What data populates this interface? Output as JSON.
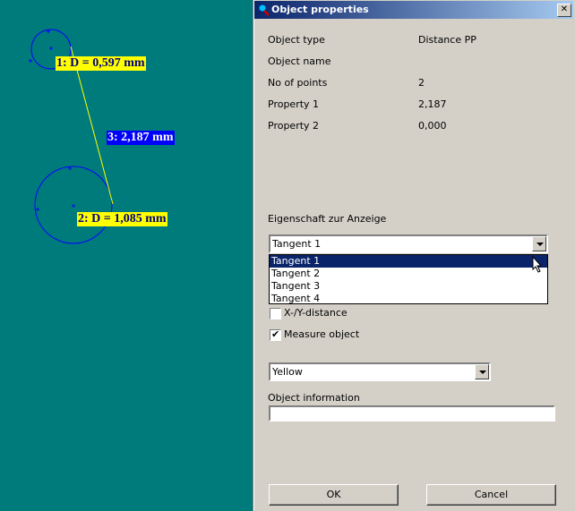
{
  "canvas": {
    "background": "#007b7b",
    "labels": [
      {
        "text": "1: D = 0,597  mm",
        "style": "yellow"
      },
      {
        "text": "3: 2,187 mm",
        "style": "blue"
      },
      {
        "text": "2: D = 1,085  mm",
        "style": "yellow"
      }
    ],
    "colors": {
      "circle": "#0000ff",
      "line": "#ffff00"
    }
  },
  "dialog": {
    "title": "Object properties",
    "close_glyph": "✕",
    "rows": [
      {
        "label": "Object type",
        "value": "Distance PP"
      },
      {
        "label": "Object name",
        "value": ""
      },
      {
        "label": "No of points",
        "value": "2"
      },
      {
        "label": "Property 1",
        "value": "2,187"
      },
      {
        "label": "Property 2",
        "value": "0,000"
      }
    ],
    "display_property": {
      "label": "Eigenschaft zur Anzeige",
      "selected": "Tangent 1",
      "options": [
        "Tangent 1",
        "Tangent 2",
        "Tangent 3",
        "Tangent 4"
      ]
    },
    "xy_distance": {
      "label": "X-/Y-distance",
      "checked": false
    },
    "measure_object": {
      "label": "Measure object",
      "checked": true,
      "mark": "✔"
    },
    "color_select": {
      "selected": "Yellow"
    },
    "object_information": {
      "label": "Object information",
      "value": ""
    },
    "ok_label": "OK",
    "cancel_label": "Cancel"
  }
}
